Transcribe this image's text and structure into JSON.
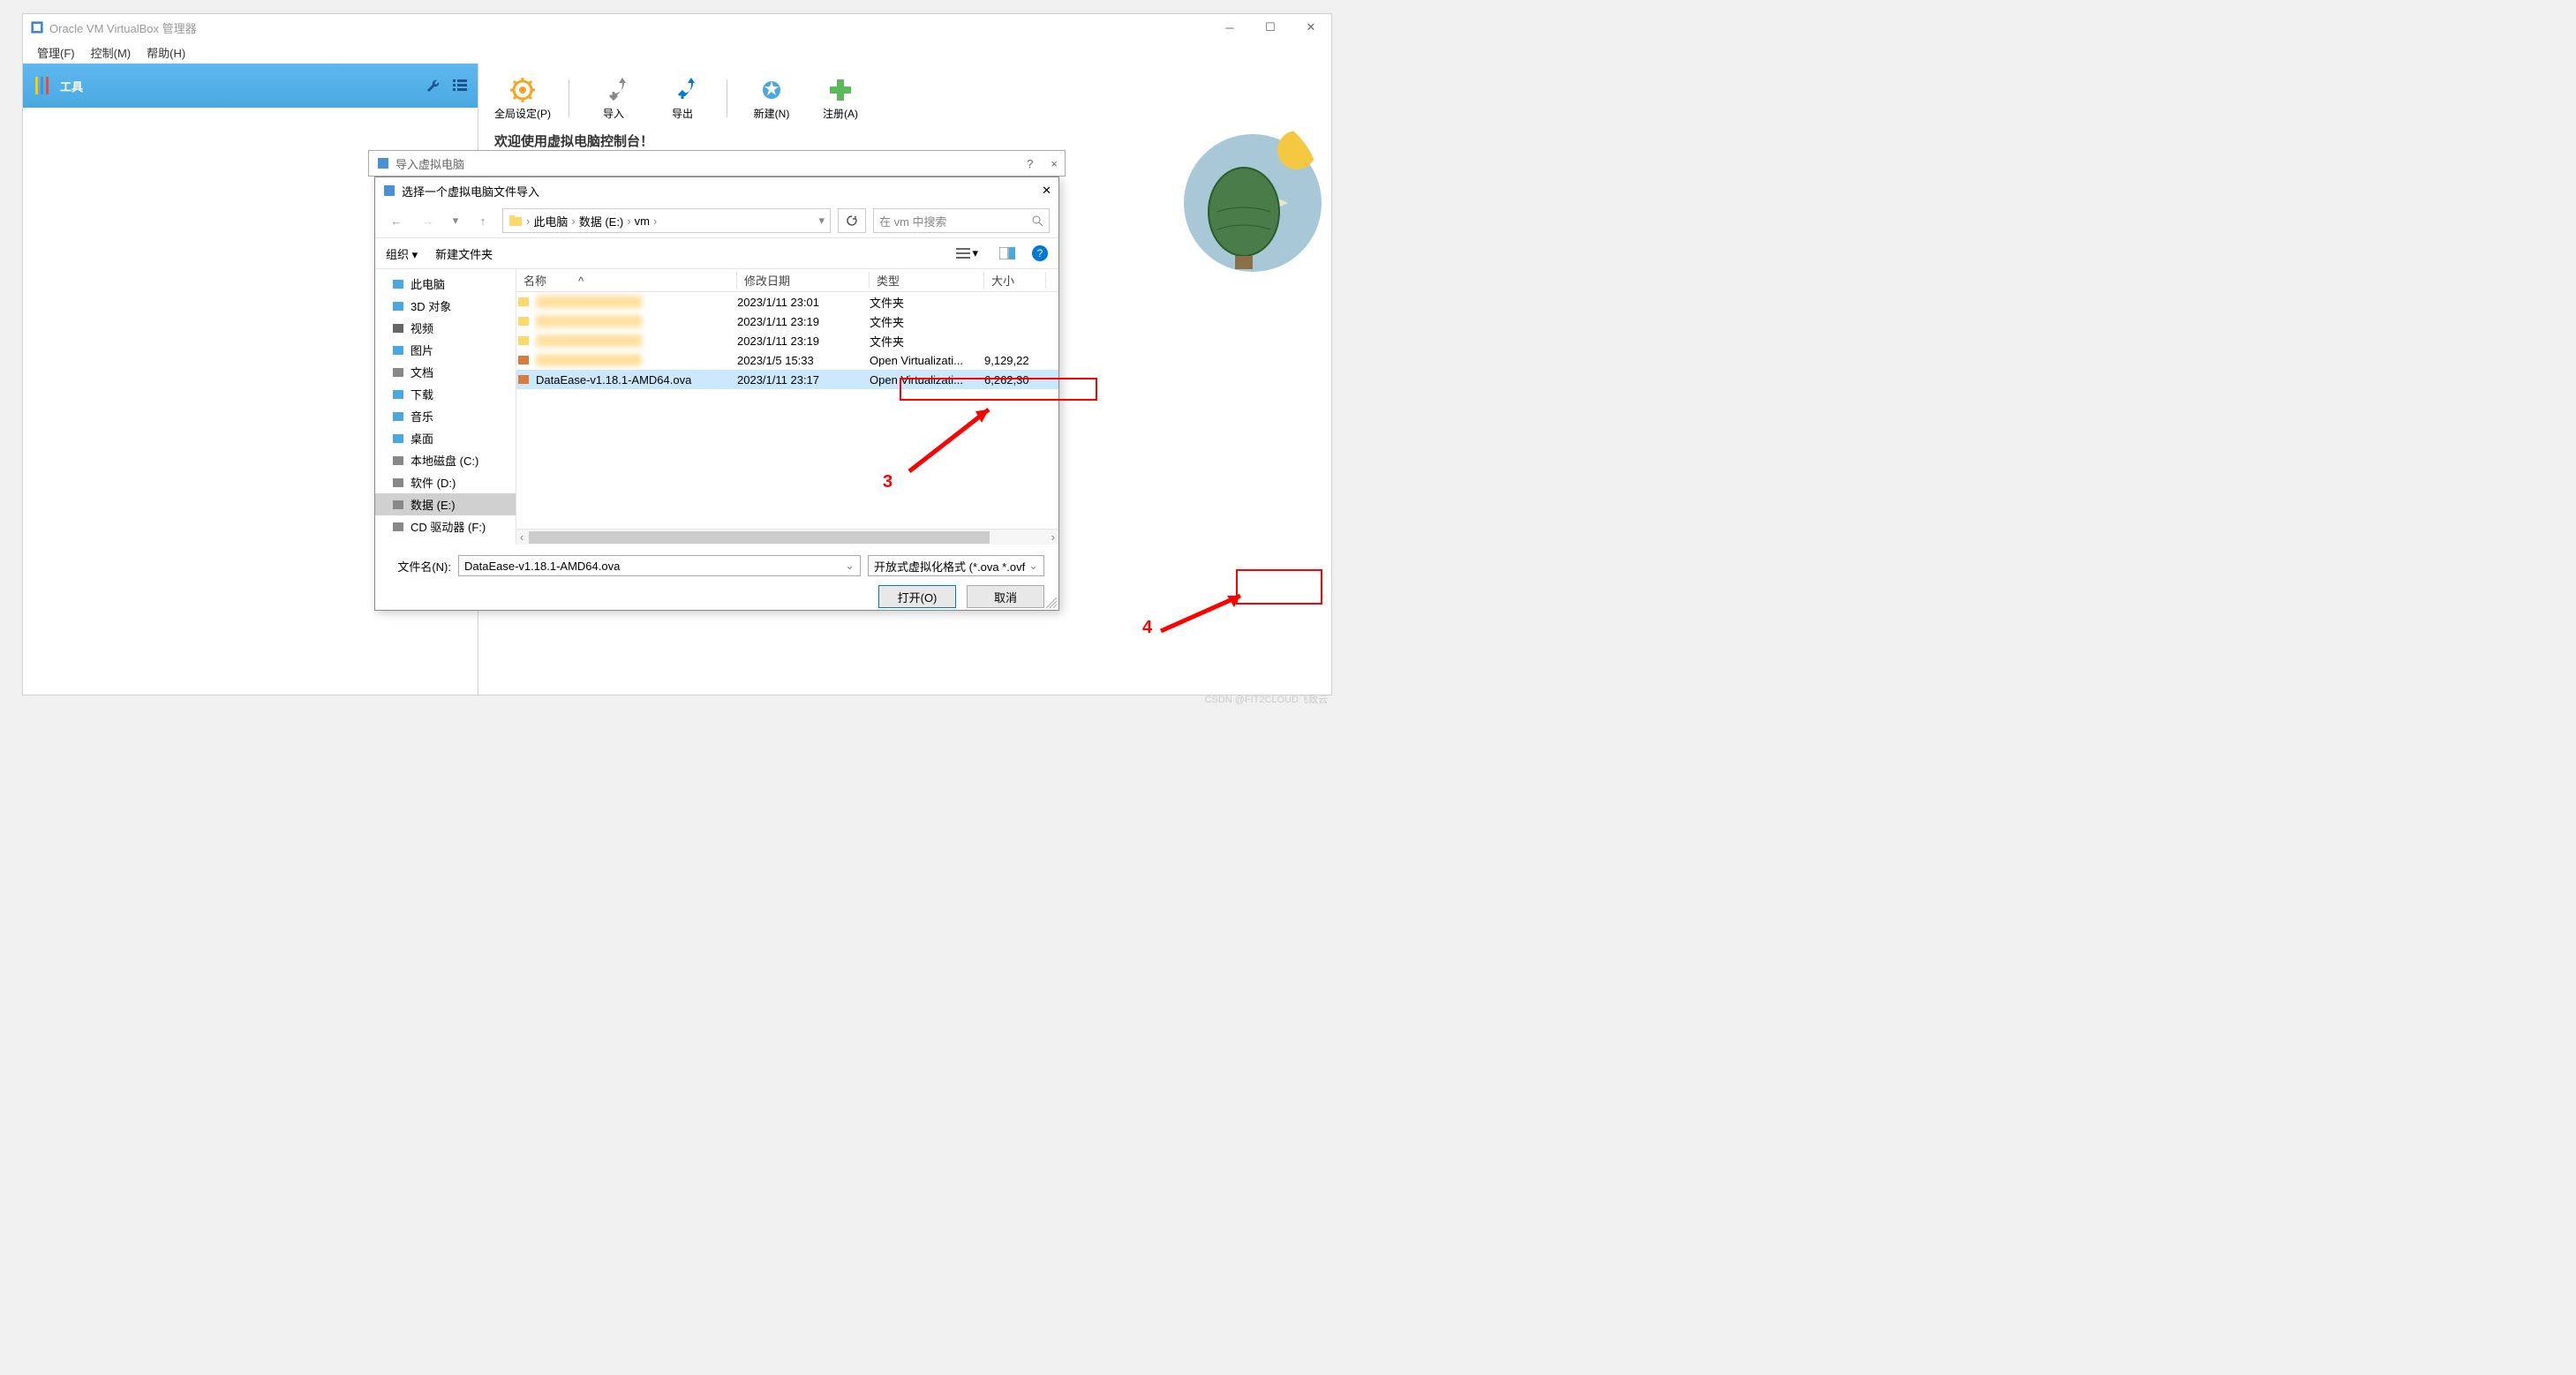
{
  "main_window": {
    "title": "Oracle VM VirtualBox 管理器",
    "menubar": {
      "file": "管理(F)",
      "control": "控制(M)",
      "help": "帮助(H)"
    },
    "sidebar": {
      "tools_label": "工具"
    },
    "toolbar": {
      "global_settings": "全局设定(P)",
      "import": "导入",
      "export": "导出",
      "new": "新建(N)",
      "register": "注册(A)"
    },
    "welcome": "欢迎使用虚拟电脑控制台！"
  },
  "import_dialog": {
    "title": "导入虚拟电脑",
    "help": "?",
    "close": "×"
  },
  "file_dialog": {
    "title": "选择一个虚拟电脑文件导入",
    "breadcrumb": {
      "root": "此电脑",
      "drive": "数据 (E:)",
      "folder": "vm"
    },
    "search_placeholder": "在 vm 中搜索",
    "toolbar": {
      "organize": "组织",
      "newfolder": "新建文件夹"
    },
    "tree": [
      {
        "icon": "pc",
        "label": "此电脑"
      },
      {
        "icon": "3d",
        "label": "3D 对象"
      },
      {
        "icon": "video",
        "label": "视频"
      },
      {
        "icon": "pic",
        "label": "图片"
      },
      {
        "icon": "doc",
        "label": "文档"
      },
      {
        "icon": "dl",
        "label": "下载"
      },
      {
        "icon": "music",
        "label": "音乐"
      },
      {
        "icon": "desktop",
        "label": "桌面"
      },
      {
        "icon": "drive",
        "label": "本地磁盘 (C:)"
      },
      {
        "icon": "drive",
        "label": "软件 (D:)"
      },
      {
        "icon": "drive",
        "label": "数据 (E:)",
        "selected": true
      },
      {
        "icon": "cd",
        "label": "CD 驱动器 (F:)"
      }
    ],
    "columns": {
      "name": "名称",
      "date": "修改日期",
      "type": "类型",
      "size": "大小"
    },
    "files": [
      {
        "name": "",
        "date": "2023/1/11 23:01",
        "type": "文件夹",
        "size": "",
        "blur": true,
        "icon": "folder"
      },
      {
        "name": "",
        "date": "2023/1/11 23:19",
        "type": "文件夹",
        "size": "",
        "blur": true,
        "icon": "folder"
      },
      {
        "name": "",
        "date": "2023/1/11 23:19",
        "type": "文件夹",
        "size": "",
        "blur": true,
        "icon": "folder"
      },
      {
        "name": "",
        "date": "2023/1/5 15:33",
        "type": "Open Virtualizati...",
        "size": "9,129,22",
        "blur": true,
        "icon": "ova"
      },
      {
        "name": "DataEase-v1.18.1-AMD64.ova",
        "date": "2023/1/11 23:17",
        "type": "Open Virtualizati...",
        "size": "6,262,30",
        "selected": true,
        "icon": "ova"
      }
    ],
    "filename_label": "文件名(N):",
    "filename_value": "DataEase-v1.18.1-AMD64.ova",
    "filter": "开放式虚拟化格式 (*.ova *.ovf",
    "open_btn": "打开(O)",
    "cancel_btn": "取消"
  },
  "annotations": {
    "num3": "3",
    "num4": "4"
  },
  "watermark": "CSDN @FIT2CLOUD飞致云"
}
